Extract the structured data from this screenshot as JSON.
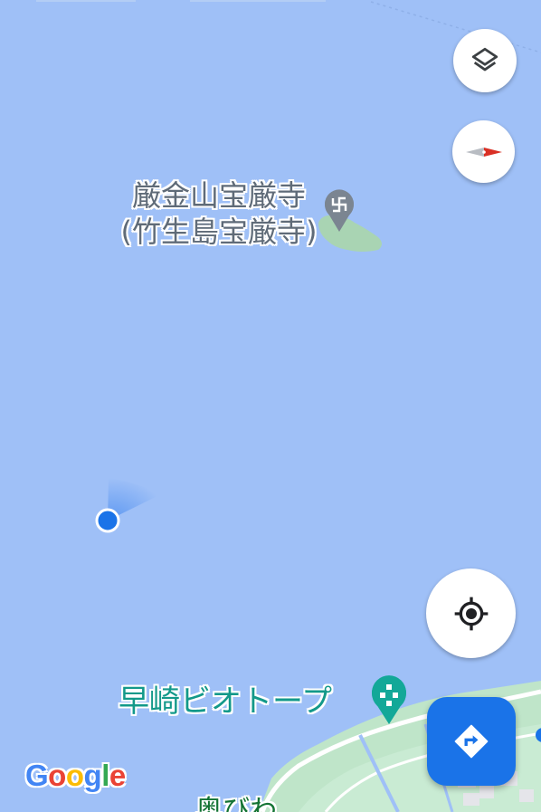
{
  "map": {
    "water_color": "#9fc0f7",
    "land_color": "#bfe5c9",
    "island_color": "#a9d4b3",
    "road_color": "#ffffff"
  },
  "labels": {
    "temple_line1": "厳金山宝厳寺",
    "temple_line2": "(竹生島宝厳寺)",
    "biotope": "早崎ビオトープ",
    "partial_place": "奥びわ"
  },
  "markers": {
    "temple_pin_icon": "manji-pin-icon",
    "biotope_pin_icon": "park-pin-icon",
    "user_location_color": "#1a73e8"
  },
  "controls": {
    "layers_icon": "layers-icon",
    "compass_icon": "compass-icon",
    "my_location_icon": "crosshair-icon",
    "directions_icon": "directions-icon"
  },
  "attribution": {
    "letters": [
      "G",
      "o",
      "o",
      "g",
      "l",
      "e"
    ],
    "colors": [
      "#4285f4",
      "#ea4335",
      "#fbbc05",
      "#4285f4",
      "#34a853",
      "#ea4335"
    ]
  }
}
